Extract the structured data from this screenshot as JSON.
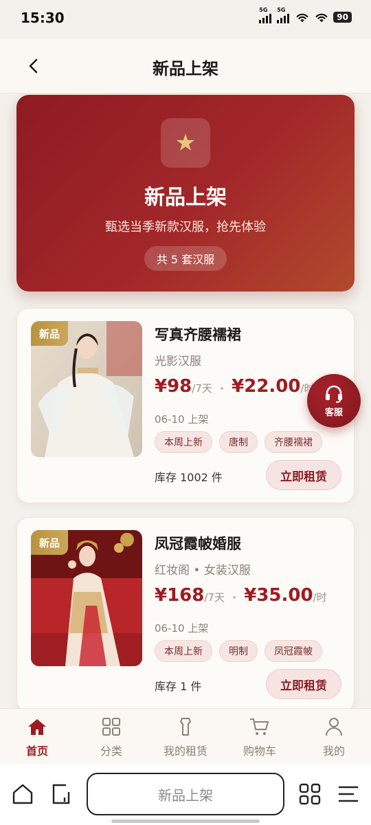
{
  "status": {
    "time": "15:30",
    "net1": "5G",
    "net2": "5G",
    "battery": "90"
  },
  "header": {
    "title": "新品上架"
  },
  "hero": {
    "title": "新品上架",
    "subtitle": "甄选当季新款汉服，抢先体验",
    "count_label": "共 5 套汉服"
  },
  "products": [
    {
      "badge": "新品",
      "name": "写真齐腰襦裙",
      "shop": "光影汉服",
      "price_week": "¥98",
      "unit_week": "/7天",
      "price_hour": "¥22.00",
      "unit_hour": "/时",
      "date": "06-10 上架",
      "tags": [
        "本周上新",
        "唐制",
        "齐腰襦裙"
      ],
      "stock": "库存 1002 件",
      "action": "立即租赁"
    },
    {
      "badge": "新品",
      "name": "凤冠霞帔婚服",
      "shop": "红妆阁 • 女装汉服",
      "price_week": "¥168",
      "unit_week": "/7天",
      "price_hour": "¥35.00",
      "unit_hour": "/时",
      "date": "06-10 上架",
      "tags": [
        "本周上新",
        "明制",
        "凤冠霞帔"
      ],
      "stock": "库存 1 件",
      "action": "立即租赁"
    }
  ],
  "service": {
    "label": "客服"
  },
  "tabs": [
    {
      "label": "首页",
      "icon": "home-icon",
      "active": true
    },
    {
      "label": "分类",
      "icon": "grid-icon"
    },
    {
      "label": "我的租赁",
      "icon": "garment-icon"
    },
    {
      "label": "购物车",
      "icon": "cart-icon"
    },
    {
      "label": "我的",
      "icon": "user-icon"
    }
  ],
  "browser": {
    "url": "新品上架"
  },
  "colors": {
    "accent": "#9f1b22",
    "hero_start": "#8e1b20",
    "hero_end": "#b04a2c",
    "badge_gold": "#b8933f"
  }
}
